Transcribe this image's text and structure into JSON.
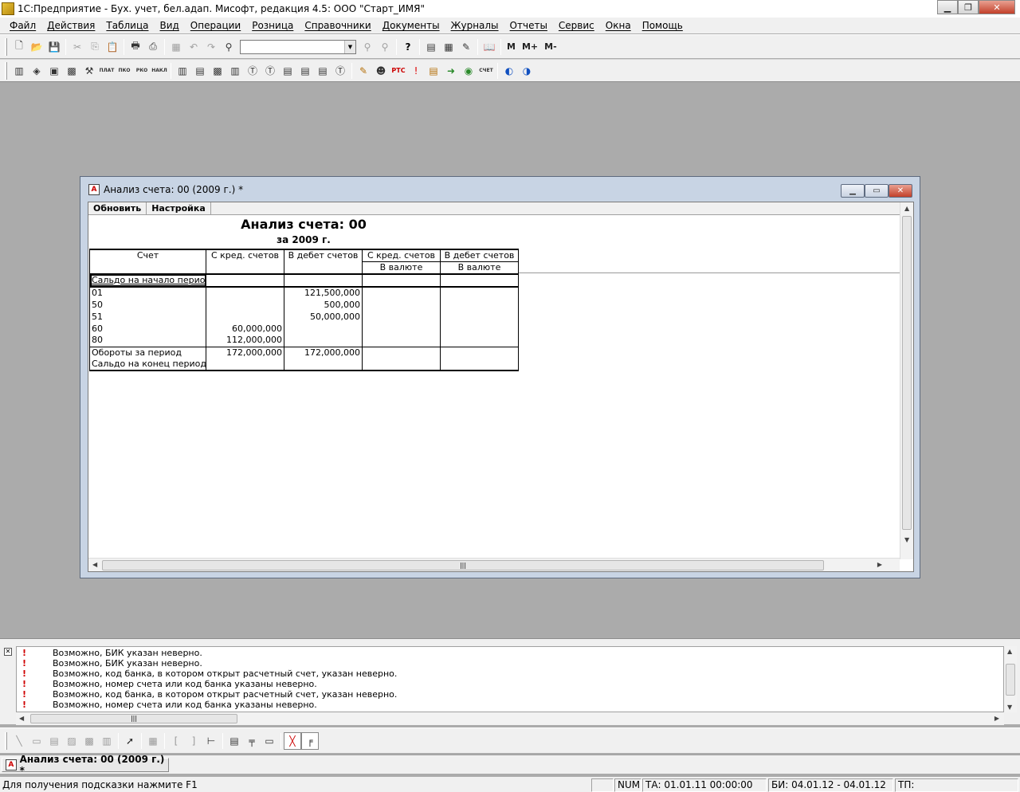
{
  "app": {
    "title": "1С:Предприятие - Бух. учет, бел.адап. Мисофт, редакция 4.5: ООО \"Старт_ИМЯ\""
  },
  "menu": [
    "Файл",
    "Действия",
    "Таблица",
    "Вид",
    "Операции",
    "Розница",
    "Справочники",
    "Документы",
    "Журналы",
    "Отчеты",
    "Сервис",
    "Окна",
    "Помощь"
  ],
  "toolbar2_labels": {
    "plat": "ПЛАТ",
    "pko": "ПКО",
    "rko": "РКО",
    "nakl": "НАКЛ",
    "schet": "СЧЕТ",
    "m": "М",
    "mplus": "М+",
    "mminus": "М-"
  },
  "report_window": {
    "title": "Анализ счета: 00 (2009 г.)  *",
    "buttons": {
      "refresh": "Обновить",
      "settings": "Настройка"
    },
    "heading": "Анализ счета: 00",
    "period": "за 2009 г.",
    "columns": [
      "Счет",
      "С кред. счетов",
      "В дебет счетов",
      "С кред. счетов",
      "В дебет счетов"
    ],
    "subcolumns": [
      "В валюте",
      "В валюте"
    ],
    "opening_label": "Сальдо на начало периода",
    "rows": [
      {
        "acc": "01",
        "cred": "",
        "deb": "121,500,000"
      },
      {
        "acc": "50",
        "cred": "",
        "deb": "500,000"
      },
      {
        "acc": "51",
        "cred": "",
        "deb": "50,000,000"
      },
      {
        "acc": "60",
        "cred": "60,000,000",
        "deb": ""
      },
      {
        "acc": "80",
        "cred": "112,000,000",
        "deb": ""
      }
    ],
    "turnover": {
      "label": "Обороты за период",
      "cred": "172,000,000",
      "deb": "172,000,000"
    },
    "closing_label": "Сальдо на конец периода"
  },
  "messages": [
    "Возможно, БИК указан неверно.",
    "Возможно, БИК указан неверно.",
    "Возможно, код банка, в котором открыт расчетный счет, указан неверно.",
    "Возможно, номер счета или код банка указаны неверно.",
    "Возможно, код банка, в котором открыт расчетный счет, указан неверно.",
    "Возможно, номер счета или код банка указаны неверно."
  ],
  "taskbar": {
    "item": "Анализ счета: 00 (2009 г.)  *"
  },
  "status": {
    "hint": "Для получения подсказки нажмите F1",
    "num": "NUM",
    "ta": "ТА: 01.01.11  00:00:00",
    "bi": "БИ: 04.01.12 - 04.01.12",
    "tp": "ТП:"
  }
}
